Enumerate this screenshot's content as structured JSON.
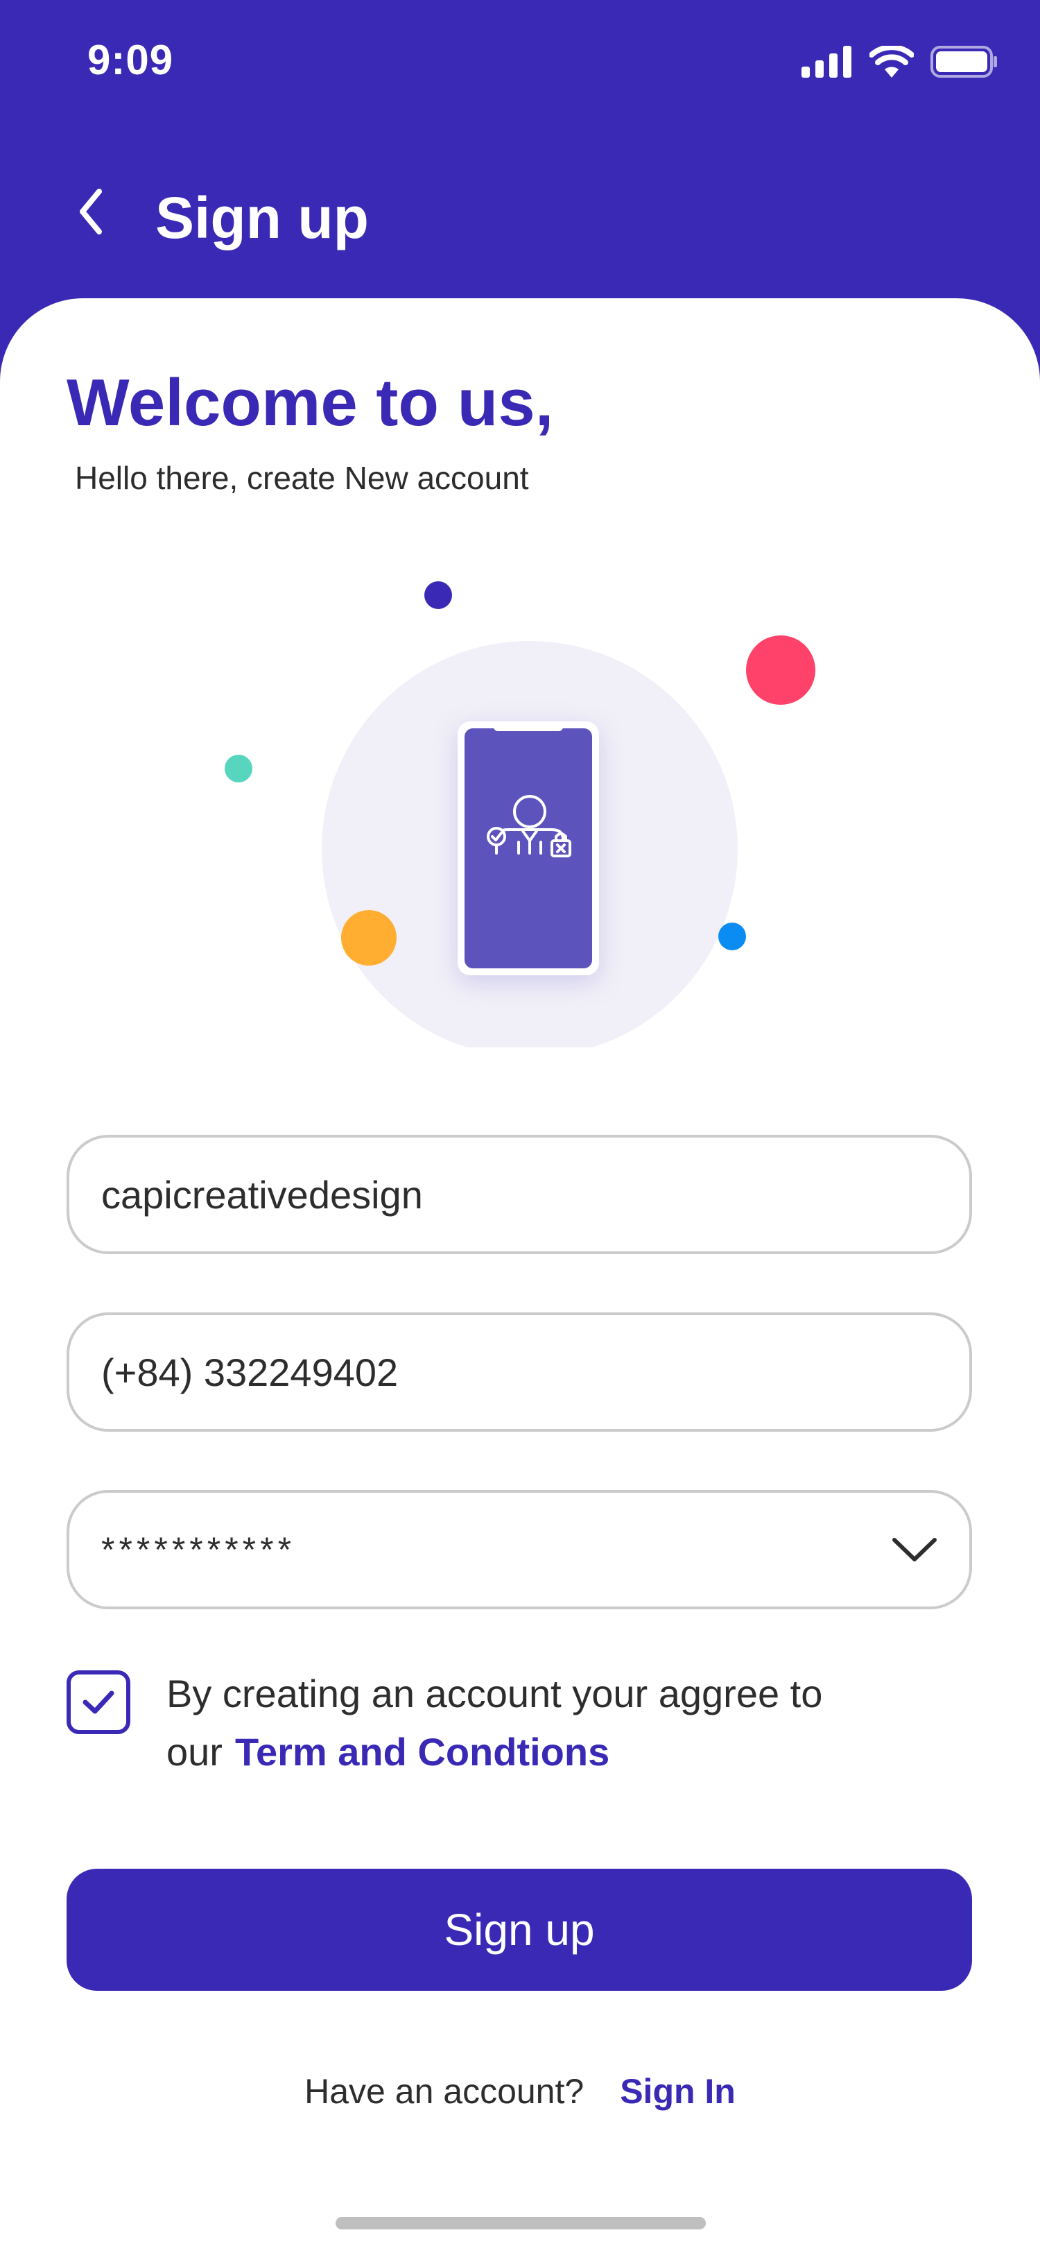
{
  "status_bar": {
    "time": "9:09"
  },
  "nav": {
    "title": "Sign up"
  },
  "header": {
    "welcome": "Welcome to us,",
    "subtitle": "Hello there, create New account"
  },
  "form": {
    "username_value": "capicreativedesign",
    "phone_value": "(+84) 332249402",
    "password_value": "***********",
    "terms_text": "By creating an account your aggree to our",
    "terms_link": "Term and Condtions",
    "terms_checked": true,
    "submit_label": "Sign up"
  },
  "footer": {
    "prompt": "Have an account?",
    "signin_label": "Sign In"
  },
  "colors": {
    "primary": "#3A29B5",
    "accent_red": "#FF4269",
    "accent_orange": "#FFAE31",
    "accent_teal": "#58D5BF",
    "accent_blue": "#0A8CF2",
    "phone_screen": "#5C54BC",
    "circle_bg": "#F1F0F8"
  },
  "icons": [
    "back-arrow-icon",
    "signal-icon",
    "wifi-icon",
    "battery-icon",
    "chevron-down-icon",
    "check-icon",
    "user-lock-icon"
  ]
}
